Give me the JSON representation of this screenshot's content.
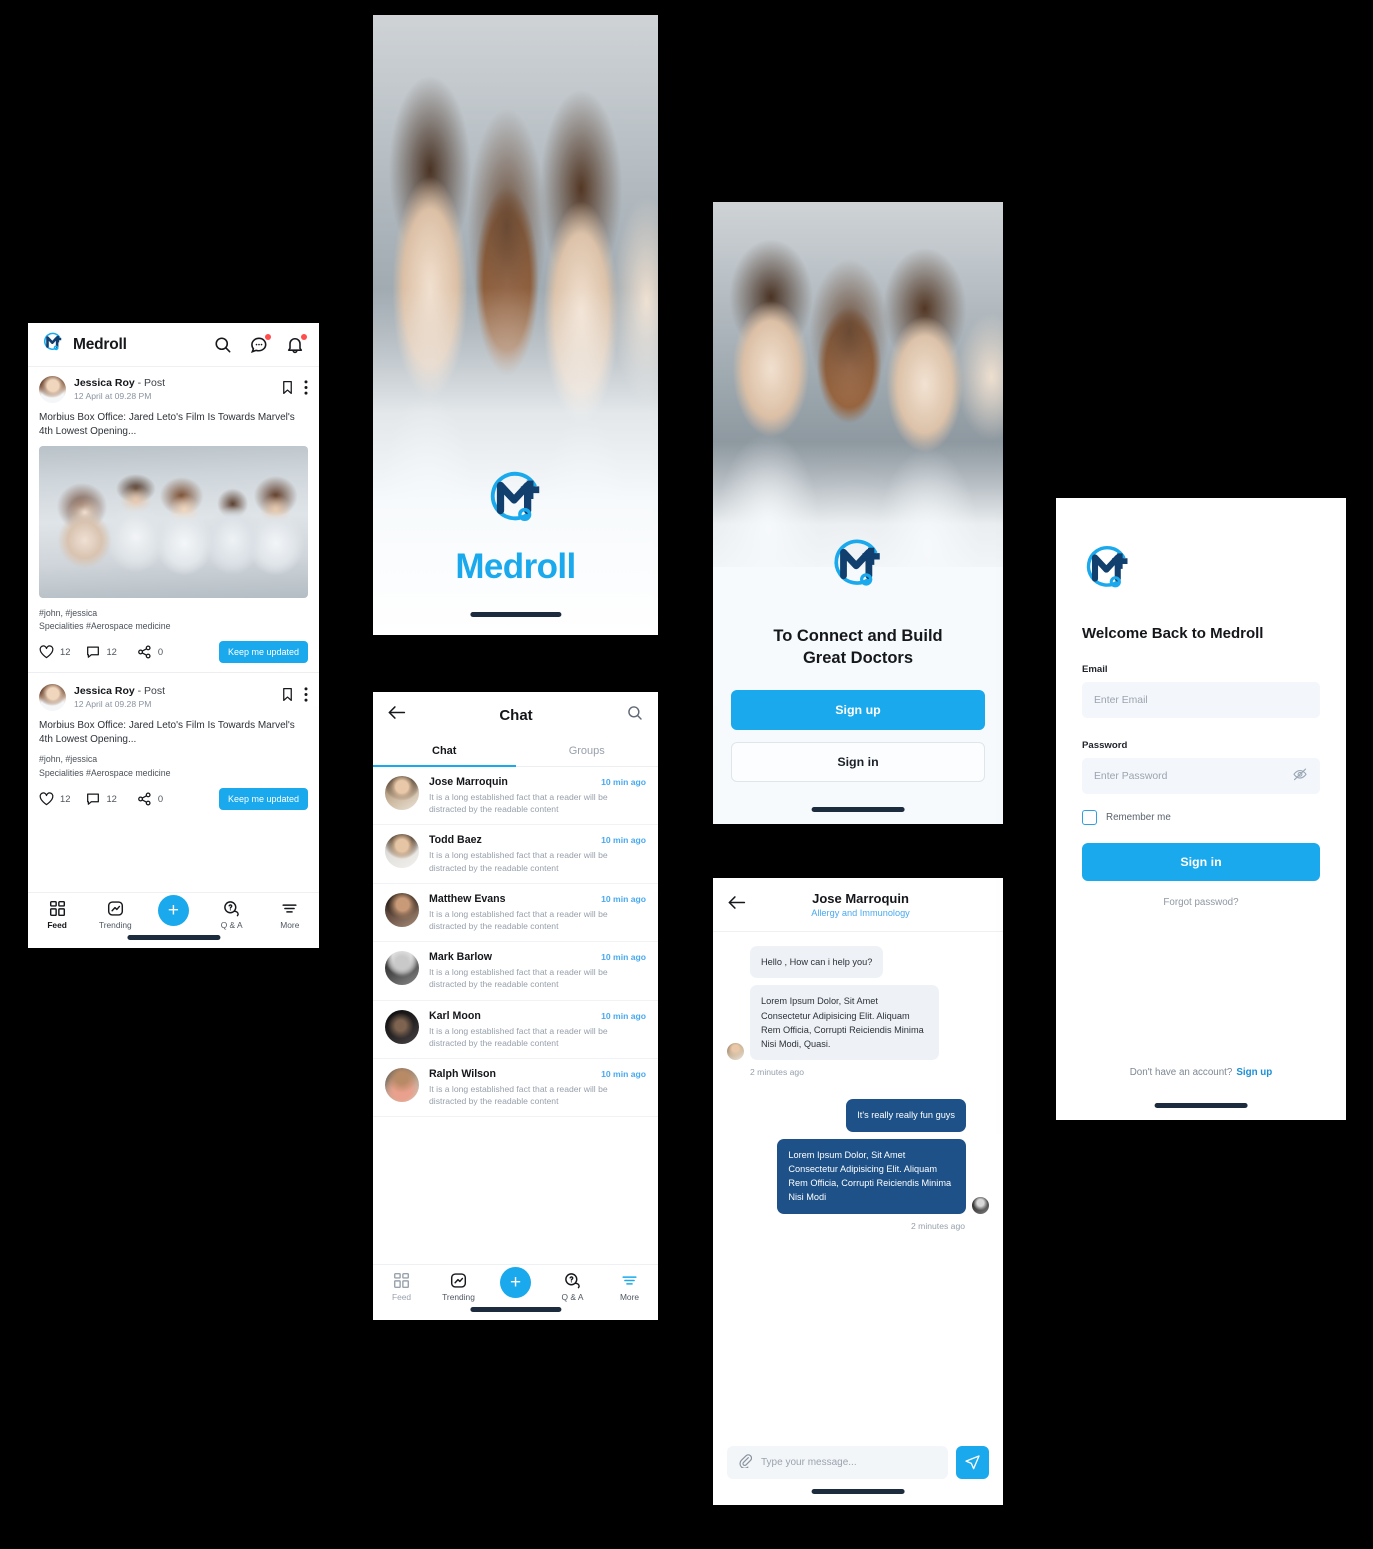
{
  "brand": {
    "name": "Medroll",
    "accent": "#19a9ec",
    "dark": "#1d5188"
  },
  "feed": {
    "header": {
      "brand_name": "Medroll",
      "search_icon": "search-icon",
      "messages_icon": "chat-bubble-icon",
      "notifications_icon": "bell-icon"
    },
    "posts": [
      {
        "author": "Jessica Roy",
        "author_suffix": " - Post",
        "time": "12 April at 09.28 PM",
        "text": "Morbius Box Office: Jared Leto's Film Is Towards Marvel's 4th Lowest Opening...",
        "tags": "#john, #jessica",
        "specialities": "Specialities #Aerospace medicine",
        "likes": "12",
        "comments": "12",
        "shares": "0",
        "cta": "Keep me updated",
        "has_photo": true
      },
      {
        "author": "Jessica Roy",
        "author_suffix": " - Post",
        "time": "12 April at 09.28 PM",
        "text": "Morbius Box Office: Jared Leto's Film Is Towards Marvel's 4th Lowest Opening...",
        "tags": "#john, #jessica",
        "specialities": "Specialities #Aerospace medicine",
        "likes": "12",
        "comments": "12",
        "shares": "0",
        "cta": "Keep me updated",
        "has_photo": false
      }
    ],
    "tabs": [
      {
        "label": "Feed",
        "icon": "grid-icon",
        "state": "active"
      },
      {
        "label": "Trending",
        "icon": "trending-icon",
        "state": "normal"
      },
      {
        "label": "",
        "icon": "plus-icon",
        "state": "fab"
      },
      {
        "label": "Q & A",
        "icon": "question-bubble-icon",
        "state": "normal"
      },
      {
        "label": "More",
        "icon": "filter-lines-icon",
        "state": "normal"
      }
    ]
  },
  "splash": {
    "wordmark": "Medroll"
  },
  "onboarding": {
    "title_line1": "To Connect and Build",
    "title_line2": "Great Doctors",
    "signup_label": "Sign up",
    "signin_label": "Sign in"
  },
  "chat_list": {
    "title": "Chat",
    "back_icon": "arrow-left-icon",
    "search_icon": "search-icon",
    "tabs": [
      {
        "label": "Chat",
        "state": "active"
      },
      {
        "label": "Groups",
        "state": "normal"
      }
    ],
    "snippet": "It is a long established fact that a reader will be distracted by the readable content",
    "rows": [
      {
        "name": "Jose Marroquin",
        "time": "10 min ago"
      },
      {
        "name": "Todd Baez",
        "time": "10 min ago"
      },
      {
        "name": "Matthew Evans",
        "time": "10 min ago"
      },
      {
        "name": "Mark Barlow",
        "time": "10 min ago"
      },
      {
        "name": "Karl Moon",
        "time": "10 min ago"
      },
      {
        "name": "Ralph Wilson",
        "time": "10 min ago"
      }
    ],
    "tabs_bottom": [
      {
        "label": "Feed",
        "icon": "grid-icon",
        "state": "dim"
      },
      {
        "label": "Trending",
        "icon": "trending-icon",
        "state": "normal"
      },
      {
        "label": "",
        "icon": "plus-icon",
        "state": "fab"
      },
      {
        "label": "Q & A",
        "icon": "question-bubble-icon",
        "state": "normal"
      },
      {
        "label": "More",
        "icon": "filter-lines-icon",
        "state": "normal"
      }
    ]
  },
  "chat_detail": {
    "name": "Jose Marroquin",
    "speciality": "Allergy and Immunology",
    "back_icon": "arrow-left-icon",
    "messages": [
      {
        "side": "in",
        "text": "Hello , How can i help you?"
      },
      {
        "side": "in",
        "text": "Lorem Ipsum Dolor, Sit Amet Consectetur Adipisicing Elit. Aliquam Rem Officia, Corrupti Reiciendis Minima Nisi Modi, Quasi."
      }
    ],
    "stamp_in": "2 minutes ago",
    "messages_out": [
      {
        "side": "out",
        "text": "It's really really fun guys"
      },
      {
        "side": "out",
        "text": "Lorem Ipsum Dolor, Sit Amet Consectetur Adipisicing Elit. Aliquam Rem Officia, Corrupti Reiciendis Minima Nisi Modi"
      }
    ],
    "stamp_out": "2 minutes ago",
    "input_placeholder": "Type your message...",
    "attach_icon": "paperclip-icon",
    "send_icon": "send-icon"
  },
  "login": {
    "title": "Welcome Back to Medroll",
    "email_label": "Email",
    "email_placeholder": "Enter Email",
    "password_label": "Password",
    "password_placeholder": "Enter Password",
    "toggle_password_icon": "eye-off-icon",
    "remember_label": "Remember me",
    "signin_label": "Sign in",
    "forgot_label": "Forgot passwod?",
    "footer_text": "Don't have an account?",
    "footer_link": "Sign up"
  }
}
